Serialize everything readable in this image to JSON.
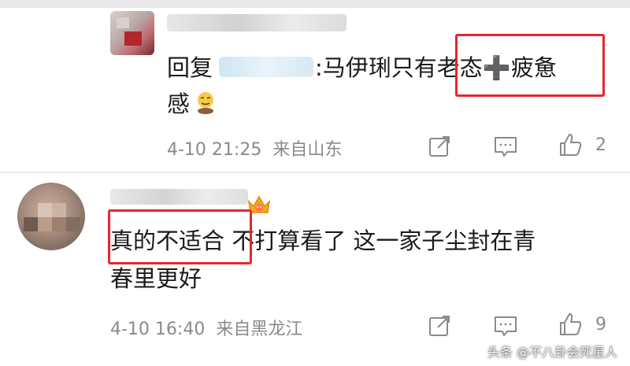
{
  "comments": [
    {
      "reply_prefix": "回复",
      "text_line1": ":马伊琍只有老态➕疲惫",
      "text_line2": "感",
      "time": "4-10 21:25",
      "location": "来自山东",
      "like_count": "2"
    },
    {
      "text_line1": "真的不适合  不打算看了  这一家子尘封在青",
      "text_line2": "春里更好",
      "time": "4-10 16:40",
      "location": "来自黑龙江",
      "like_count": "9"
    }
  ],
  "watermark": "头条 @不八卦会死星人",
  "colors": {
    "highlight_box": "#e8262c",
    "meta_text": "#8a8a8a"
  },
  "icons": [
    "share-icon",
    "comment-icon",
    "like-icon",
    "crown-badge-icon",
    "emoji-icon"
  ]
}
